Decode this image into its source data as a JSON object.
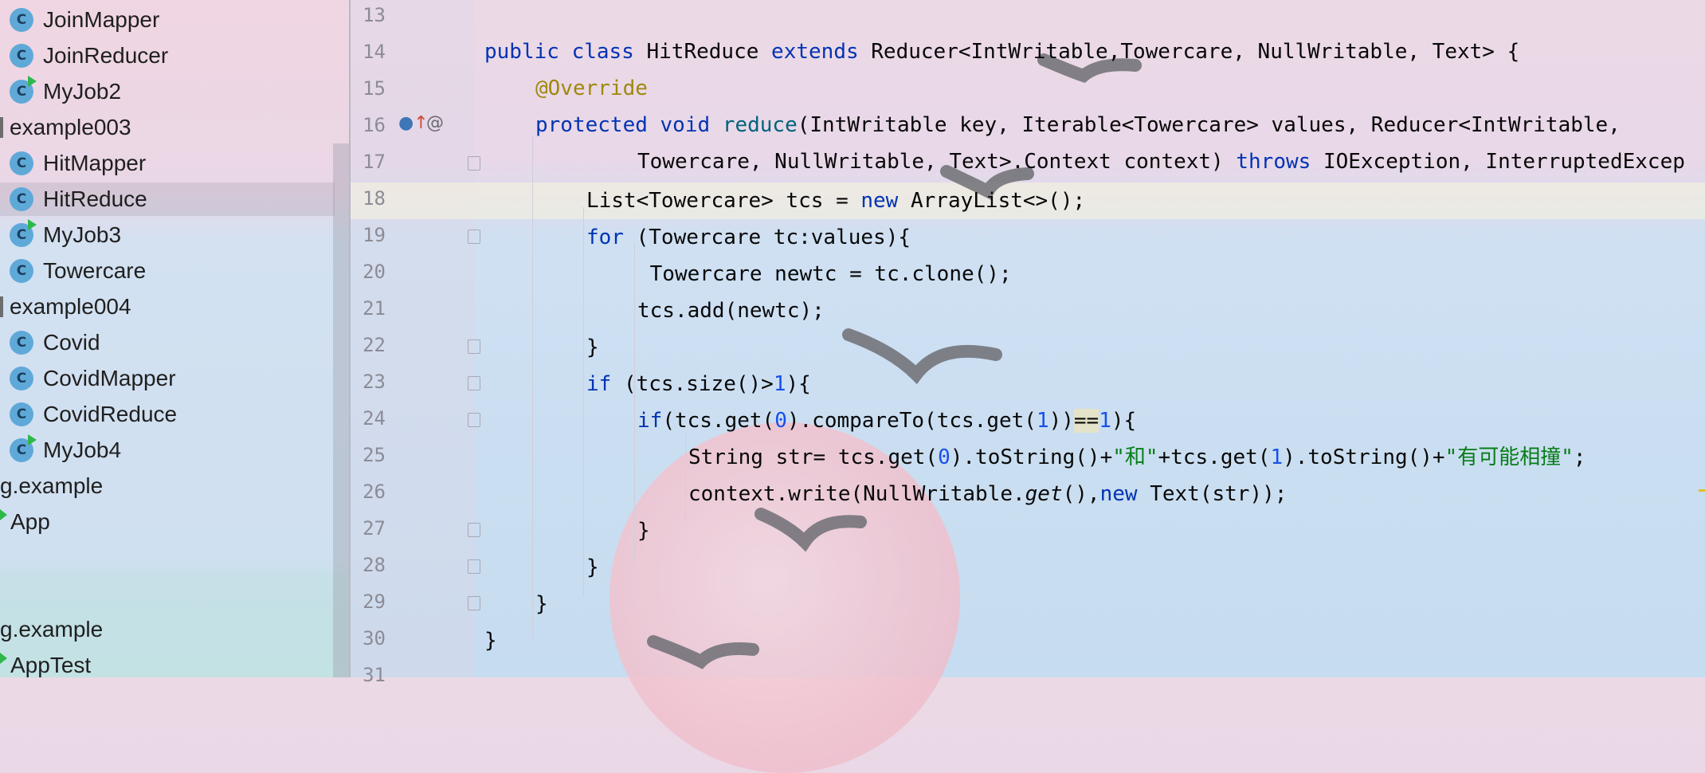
{
  "project_tree": {
    "items": [
      {
        "label": "JoinMapper",
        "kind": "class"
      },
      {
        "label": "JoinReducer",
        "kind": "class"
      },
      {
        "label": "MyJob2",
        "kind": "runnable-class"
      },
      {
        "label": "example003",
        "kind": "package"
      },
      {
        "label": "HitMapper",
        "kind": "class"
      },
      {
        "label": "HitReduce",
        "kind": "class",
        "selected": true
      },
      {
        "label": "MyJob3",
        "kind": "runnable-class"
      },
      {
        "label": "Towercare",
        "kind": "class"
      },
      {
        "label": "example004",
        "kind": "package"
      },
      {
        "label": "Covid",
        "kind": "class"
      },
      {
        "label": "CovidMapper",
        "kind": "class"
      },
      {
        "label": "CovidReduce",
        "kind": "class"
      },
      {
        "label": "MyJob4",
        "kind": "runnable-class"
      },
      {
        "label": "g.example",
        "kind": "package"
      },
      {
        "label": "App",
        "kind": "app"
      },
      {
        "label": "g.example",
        "kind": "package"
      },
      {
        "label": "AppTest",
        "kind": "app"
      }
    ],
    "class_icon_letter": "C"
  },
  "editor": {
    "line_numbers": [
      "13",
      "14",
      "15",
      "16",
      "17",
      "18",
      "19",
      "20",
      "21",
      "22",
      "23",
      "24",
      "25",
      "26",
      "27",
      "28",
      "29",
      "30",
      "31"
    ],
    "gutter_icons": {
      "override": "o↑",
      "annotation": "@"
    },
    "code": {
      "l14": {
        "a": "public class ",
        "b": "HitReduce ",
        "c": "extends ",
        "d": "Reducer<IntWritable,Towercare, NullWritable, Text> {"
      },
      "l15": {
        "a": "@Override"
      },
      "l16": {
        "a": "protected void ",
        "b": "reduce",
        "c": "(IntWritable key, Iterable<Towercare> values, Reducer<IntWritable,"
      },
      "l17": {
        "a": "Towercare, NullWritable, Text>.Context context) ",
        "b": "throws ",
        "c": "IOException, InterruptedExcep"
      },
      "l18": {
        "a": "List<Towercare> tcs = ",
        "b": "new ",
        "c": "ArrayList<>();"
      },
      "l19": {
        "a": "for ",
        "b": "(Towercare tc:values){"
      },
      "l20": {
        "a": " Towercare newtc = tc.clone();"
      },
      "l21": {
        "a": "tcs.add(newtc);"
      },
      "l22": {
        "a": "}"
      },
      "l23": {
        "a": "if ",
        "b": "(tcs.size()>",
        "c": "1",
        "d": "){"
      },
      "l24": {
        "a": "if",
        "b": "(tcs.get(",
        "c": "0",
        "d": ").compareTo(tcs.get(",
        "e": "1",
        "f": "))",
        "g": "==",
        "h": "1",
        "i": "){"
      },
      "l25": {
        "a": "String str= tcs.get(",
        "b": "0",
        "c": ").toString()+",
        "d": "\"和\"",
        "e": "+tcs.get(",
        "f": "1",
        "g": ").toString()+",
        "h": "\"有可能相撞\"",
        "i": ";"
      },
      "l26": {
        "a": "context.write(NullWritable.",
        "b": "get",
        "c": "(),",
        "d": "new ",
        "e": "Text(str));"
      },
      "l27": {
        "a": "}"
      },
      "l28": {
        "a": "}"
      },
      "l29": {
        "a": "}"
      },
      "l30": {
        "a": "}"
      }
    }
  },
  "colors": {
    "keyword": "#0033b3",
    "annotation": "#9e880d",
    "function": "#00627a",
    "number": "#1750eb",
    "string": "#067d17"
  }
}
